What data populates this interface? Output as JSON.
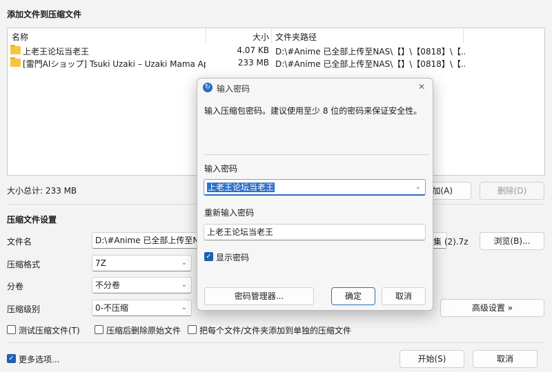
{
  "window": {
    "title": "添加文件到压缩文件"
  },
  "filelist": {
    "columns": {
      "name": "名称",
      "size": "大小",
      "path": "文件夹路径"
    },
    "rows": [
      {
        "name": "上老王论坛当老王",
        "size": "4.07 KB",
        "path": "D:\\#Anime 已全部上传至NAS\\【】\\【0818】\\【..."
      },
      {
        "name": "[雷門AIショップ] Tsuki Uzaki – Uzaki Mama Ap...",
        "size": "233 MB",
        "path": "D:\\#Anime 已全部上传至NAS\\【】\\【0818】\\【..."
      }
    ]
  },
  "summary": {
    "total_size": "大小总计: 233 MB"
  },
  "list_buttons": {
    "add": "加(A)",
    "delete": "删除(D)"
  },
  "settings": {
    "title": "压缩文件设置",
    "filename_label": "文件名",
    "filename_value": "D:\\#Anime 已全部上传至NA",
    "filename_tail": "集 (2).7z",
    "browse": "浏览(B)...",
    "format_label": "压缩格式",
    "format_value": "7Z",
    "split_label": "分卷",
    "split_value": "不分卷",
    "level_label": "压缩级别",
    "level_value": "0-不压缩",
    "advanced": "高级设置 »",
    "opt_test": "测试压缩文件(T)",
    "opt_delete": "压缩后删除原始文件",
    "opt_separate": "把每个文件/文件夹添加到单独的压缩文件"
  },
  "footer": {
    "more_options": "更多选项...",
    "start": "开始(S)",
    "cancel": "取消"
  },
  "dialog": {
    "title": "输入密码",
    "description": "输入压缩包密码。建议使用至少 8 位的密码来保证安全性。",
    "password_label": "输入密码",
    "password_value": "上老王论坛当老王",
    "repeat_label": "重新输入密码",
    "repeat_value": "上老王论坛当老王",
    "show_password": "显示密码",
    "manager_button": "密码管理器...",
    "ok_button": "确定",
    "cancel_button": "取消",
    "close_glyph": "✕"
  }
}
